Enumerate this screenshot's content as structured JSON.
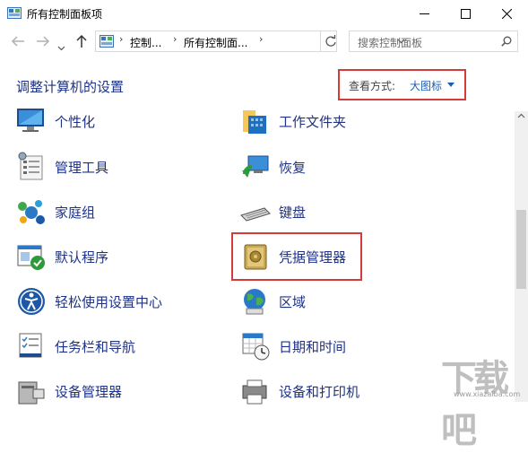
{
  "window": {
    "title": "所有控制面板项"
  },
  "address": {
    "crumbs": [
      "控制...",
      "所有控制面..."
    ],
    "search_placeholder": "搜索控制面板"
  },
  "header": {
    "title": "调整计算机的设置",
    "view_label": "查看方式:",
    "view_value": "大图标"
  },
  "items": {
    "left": [
      "个性化",
      "管理工具",
      "家庭组",
      "默认程序",
      "轻松使用设置中心",
      "任务栏和导航",
      "设备管理器"
    ],
    "right": [
      "工作文件夹",
      "恢复",
      "键盘",
      "凭据管理器",
      "区域",
      "日期和时间",
      "设备和打印机"
    ]
  },
  "watermark": {
    "text": "下载吧",
    "url": "www.xiazaiba.com"
  },
  "colors": {
    "link": "#1e3287",
    "highlight": "#d43b3b",
    "accent": "#1a5fb4"
  }
}
